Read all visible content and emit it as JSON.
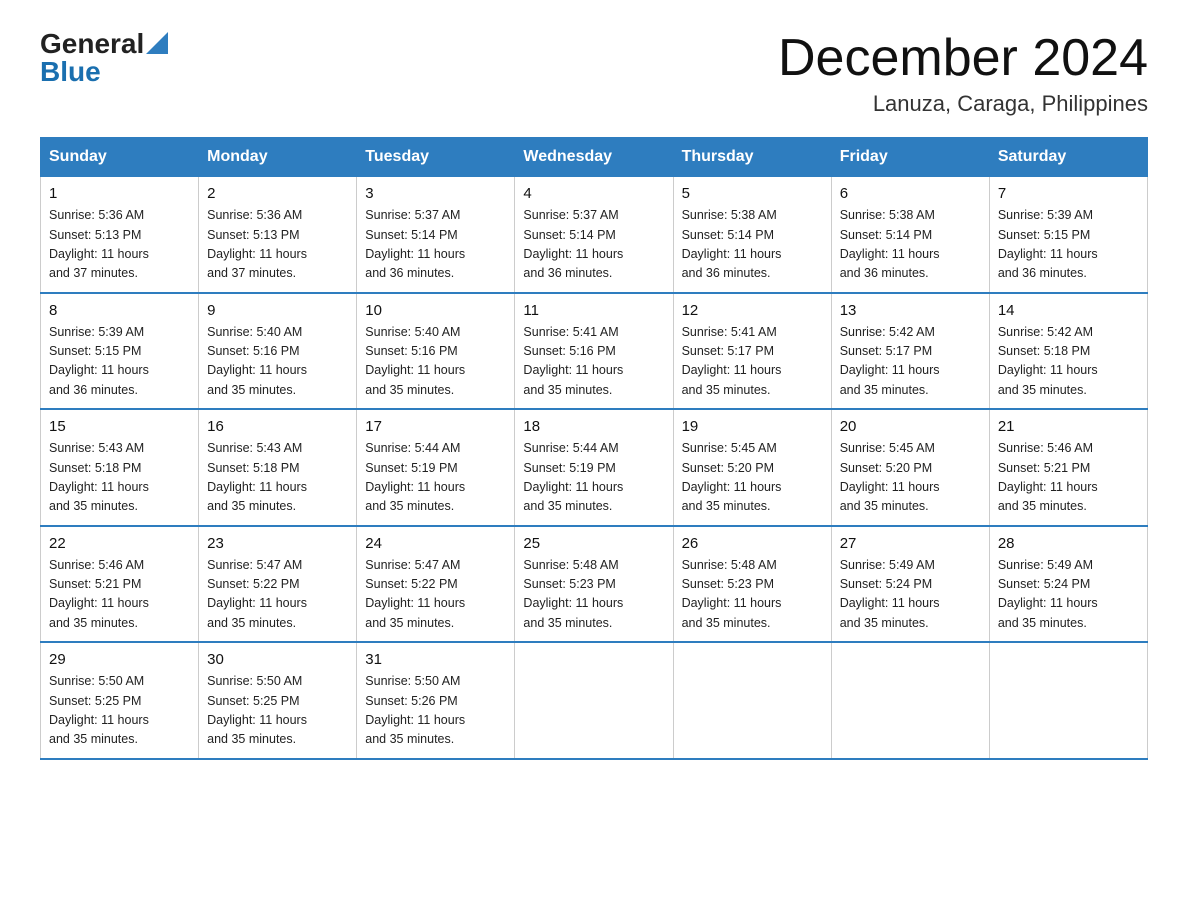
{
  "header": {
    "logo_general": "General",
    "logo_blue": "Blue",
    "month_title": "December 2024",
    "location": "Lanuza, Caraga, Philippines"
  },
  "days_of_week": [
    "Sunday",
    "Monday",
    "Tuesday",
    "Wednesday",
    "Thursday",
    "Friday",
    "Saturday"
  ],
  "weeks": [
    [
      {
        "day": "1",
        "sunrise": "5:36 AM",
        "sunset": "5:13 PM",
        "daylight": "11 hours and 37 minutes."
      },
      {
        "day": "2",
        "sunrise": "5:36 AM",
        "sunset": "5:13 PM",
        "daylight": "11 hours and 37 minutes."
      },
      {
        "day": "3",
        "sunrise": "5:37 AM",
        "sunset": "5:14 PM",
        "daylight": "11 hours and 36 minutes."
      },
      {
        "day": "4",
        "sunrise": "5:37 AM",
        "sunset": "5:14 PM",
        "daylight": "11 hours and 36 minutes."
      },
      {
        "day": "5",
        "sunrise": "5:38 AM",
        "sunset": "5:14 PM",
        "daylight": "11 hours and 36 minutes."
      },
      {
        "day": "6",
        "sunrise": "5:38 AM",
        "sunset": "5:14 PM",
        "daylight": "11 hours and 36 minutes."
      },
      {
        "day": "7",
        "sunrise": "5:39 AM",
        "sunset": "5:15 PM",
        "daylight": "11 hours and 36 minutes."
      }
    ],
    [
      {
        "day": "8",
        "sunrise": "5:39 AM",
        "sunset": "5:15 PM",
        "daylight": "11 hours and 36 minutes."
      },
      {
        "day": "9",
        "sunrise": "5:40 AM",
        "sunset": "5:16 PM",
        "daylight": "11 hours and 35 minutes."
      },
      {
        "day": "10",
        "sunrise": "5:40 AM",
        "sunset": "5:16 PM",
        "daylight": "11 hours and 35 minutes."
      },
      {
        "day": "11",
        "sunrise": "5:41 AM",
        "sunset": "5:16 PM",
        "daylight": "11 hours and 35 minutes."
      },
      {
        "day": "12",
        "sunrise": "5:41 AM",
        "sunset": "5:17 PM",
        "daylight": "11 hours and 35 minutes."
      },
      {
        "day": "13",
        "sunrise": "5:42 AM",
        "sunset": "5:17 PM",
        "daylight": "11 hours and 35 minutes."
      },
      {
        "day": "14",
        "sunrise": "5:42 AM",
        "sunset": "5:18 PM",
        "daylight": "11 hours and 35 minutes."
      }
    ],
    [
      {
        "day": "15",
        "sunrise": "5:43 AM",
        "sunset": "5:18 PM",
        "daylight": "11 hours and 35 minutes."
      },
      {
        "day": "16",
        "sunrise": "5:43 AM",
        "sunset": "5:18 PM",
        "daylight": "11 hours and 35 minutes."
      },
      {
        "day": "17",
        "sunrise": "5:44 AM",
        "sunset": "5:19 PM",
        "daylight": "11 hours and 35 minutes."
      },
      {
        "day": "18",
        "sunrise": "5:44 AM",
        "sunset": "5:19 PM",
        "daylight": "11 hours and 35 minutes."
      },
      {
        "day": "19",
        "sunrise": "5:45 AM",
        "sunset": "5:20 PM",
        "daylight": "11 hours and 35 minutes."
      },
      {
        "day": "20",
        "sunrise": "5:45 AM",
        "sunset": "5:20 PM",
        "daylight": "11 hours and 35 minutes."
      },
      {
        "day": "21",
        "sunrise": "5:46 AM",
        "sunset": "5:21 PM",
        "daylight": "11 hours and 35 minutes."
      }
    ],
    [
      {
        "day": "22",
        "sunrise": "5:46 AM",
        "sunset": "5:21 PM",
        "daylight": "11 hours and 35 minutes."
      },
      {
        "day": "23",
        "sunrise": "5:47 AM",
        "sunset": "5:22 PM",
        "daylight": "11 hours and 35 minutes."
      },
      {
        "day": "24",
        "sunrise": "5:47 AM",
        "sunset": "5:22 PM",
        "daylight": "11 hours and 35 minutes."
      },
      {
        "day": "25",
        "sunrise": "5:48 AM",
        "sunset": "5:23 PM",
        "daylight": "11 hours and 35 minutes."
      },
      {
        "day": "26",
        "sunrise": "5:48 AM",
        "sunset": "5:23 PM",
        "daylight": "11 hours and 35 minutes."
      },
      {
        "day": "27",
        "sunrise": "5:49 AM",
        "sunset": "5:24 PM",
        "daylight": "11 hours and 35 minutes."
      },
      {
        "day": "28",
        "sunrise": "5:49 AM",
        "sunset": "5:24 PM",
        "daylight": "11 hours and 35 minutes."
      }
    ],
    [
      {
        "day": "29",
        "sunrise": "5:50 AM",
        "sunset": "5:25 PM",
        "daylight": "11 hours and 35 minutes."
      },
      {
        "day": "30",
        "sunrise": "5:50 AM",
        "sunset": "5:25 PM",
        "daylight": "11 hours and 35 minutes."
      },
      {
        "day": "31",
        "sunrise": "5:50 AM",
        "sunset": "5:26 PM",
        "daylight": "11 hours and 35 minutes."
      },
      null,
      null,
      null,
      null
    ]
  ],
  "labels": {
    "sunrise": "Sunrise:",
    "sunset": "Sunset:",
    "daylight": "Daylight:"
  }
}
